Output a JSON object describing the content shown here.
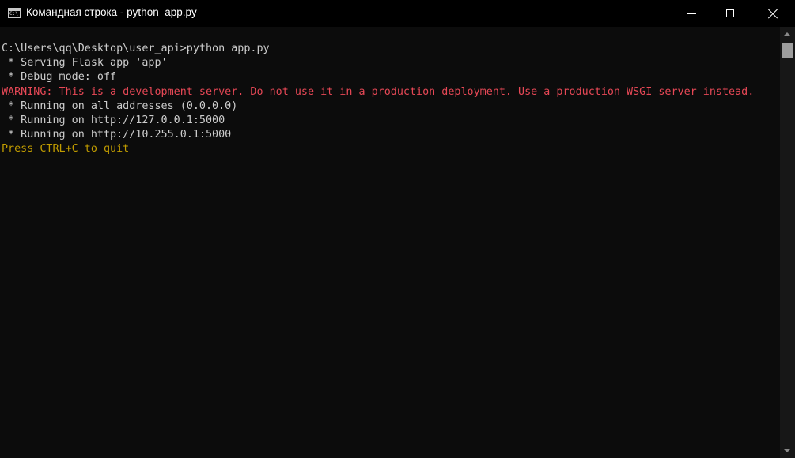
{
  "window": {
    "title": "Командная строка - python  app.py",
    "icon": "console-icon",
    "icon_text": "C:\\"
  },
  "controls": {
    "minimize_icon": "minimize-icon",
    "maximize_icon": "maximize-icon",
    "close_icon": "close-icon"
  },
  "console": {
    "lines": [
      {
        "text": "C:\\Users\\qq\\Desktop\\user_api>python app.py",
        "style": "normal"
      },
      {
        "text": " * Serving Flask app 'app'",
        "style": "normal"
      },
      {
        "text": " * Debug mode: off",
        "style": "normal"
      },
      {
        "text": "WARNING: This is a development server. Do not use it in a production deployment. Use a production WSGI server instead.",
        "style": "warning"
      },
      {
        "text": " * Running on all addresses (0.0.0.0)",
        "style": "normal"
      },
      {
        "text": " * Running on http://127.0.0.1:5000",
        "style": "normal"
      },
      {
        "text": " * Running on http://10.255.0.1:5000",
        "style": "normal"
      },
      {
        "text": "Press CTRL+C to quit",
        "style": "quit"
      }
    ]
  },
  "colors": {
    "background": "#0c0c0c",
    "titlebar": "#000000",
    "text": "#cccccc",
    "warning": "#e74856",
    "quit": "#c19c00"
  }
}
